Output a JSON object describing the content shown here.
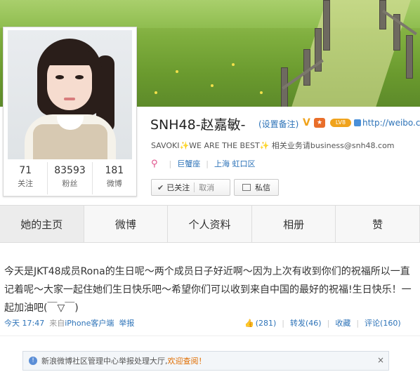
{
  "profile": {
    "name": "SNH48-赵嘉敏-",
    "set_remark": "(设置备注)",
    "verified_badge": "V",
    "level_badge": "LV8",
    "url": "http://weibo.com/",
    "bio": "SAVOKI✨WE ARE THE BEST✨ 相关业务请business@snh48.com",
    "gender_icon": "female-icon",
    "constellation": "巨蟹座",
    "location": "上海 虹口区"
  },
  "stats": [
    {
      "num": "71",
      "label": "关注"
    },
    {
      "num": "83593",
      "label": "粉丝"
    },
    {
      "num": "181",
      "label": "微博"
    }
  ],
  "buttons": {
    "followed": "已关注",
    "cancel": "取消",
    "message": "私信"
  },
  "tabs": [
    "她的主页",
    "微博",
    "个人资料",
    "相册",
    "赞"
  ],
  "post": {
    "text": "今天是JKT48成员Rona的生日呢～两个成员日子好近啊～因为上次有收到你们的祝福所以一直记着呢～大家一起住她们生日快乐吧～希望你们可以收到来自中国的最好的祝福!生日快乐！一起加油吧(￣▽￣)",
    "time": "今天 17:47",
    "source_prefix": "来自",
    "source": "iPhone客户端",
    "report": "举报",
    "likes": "(281)",
    "repost": "转发(46)",
    "favorite": "收藏",
    "comment": "评论(160)"
  },
  "notice": {
    "text": "新浪微博社区管理中心举报处理大厅,",
    "link": "欢迎查阅！",
    "close": "×"
  },
  "colors": {
    "link": "#2d73b8",
    "accent": "#f0a31c",
    "notice_link": "#e06d00"
  }
}
